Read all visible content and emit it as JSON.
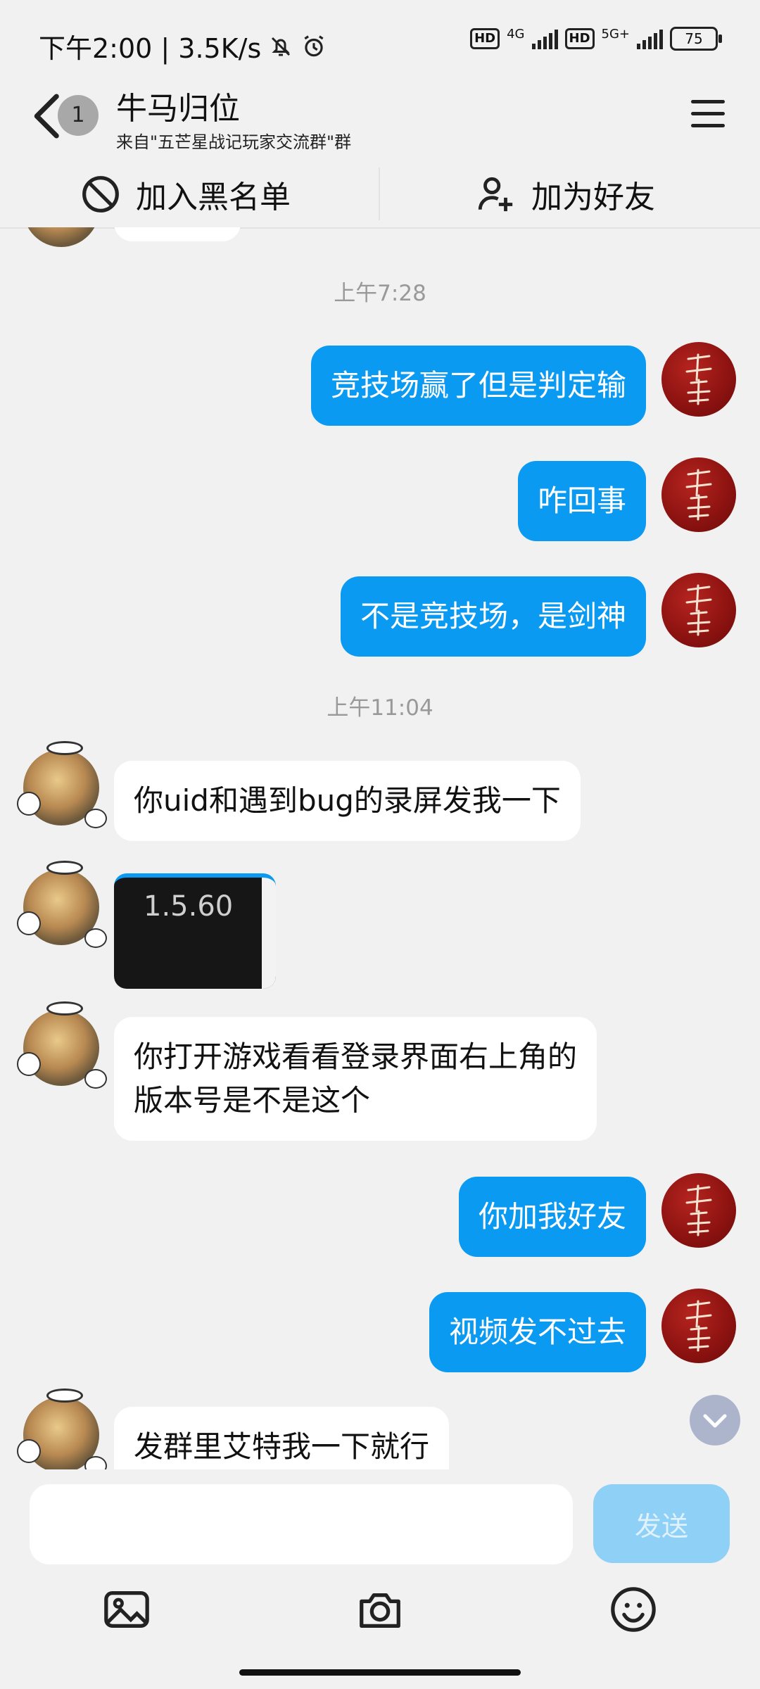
{
  "status_bar": {
    "time_speed": "下午2:00 | 3.5K/s",
    "hd1": "HD",
    "net1": "4G",
    "hd2": "HD",
    "net2": "5G+",
    "battery": "75"
  },
  "header": {
    "unread_count": "1",
    "title": "牛马归位",
    "subtitle": "来自\"五芒星战记玩家交流群\"群"
  },
  "actions": {
    "blacklist_label": "加入黑名单",
    "add_friend_label": "加为好友"
  },
  "chat": {
    "time1": "上午7:28",
    "msg1": "竞技场赢了但是判定输",
    "msg2": "咋回事",
    "msg3": "不是竞技场，是剑神",
    "time2": "上午11:04",
    "msg4": "你uid和遇到bug的录屏发我一下",
    "image_text": "1.5.60",
    "msg5_line1": "你打开游戏看看登录界面右上角的",
    "msg5_line2": "版本号是不是这个",
    "msg6": "你加我好友",
    "msg7": "视频发不过去",
    "msg8": "发群里艾特我一下就行"
  },
  "composer": {
    "input_value": "",
    "send_label": "发送"
  },
  "colors": {
    "my_bubble": "#0a9af2",
    "send_disabled": "#8fd0f7"
  }
}
